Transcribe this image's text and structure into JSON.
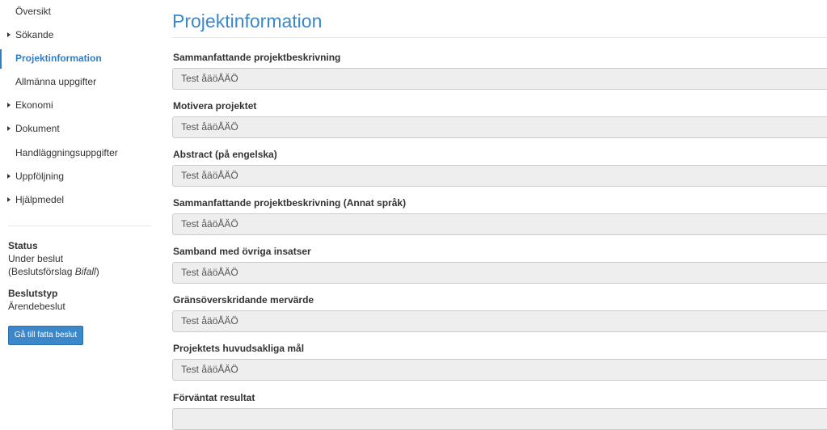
{
  "sidebar": {
    "nav": [
      {
        "label": "Översikt",
        "caret": false,
        "active": false
      },
      {
        "label": "Sökande",
        "caret": true,
        "active": false
      },
      {
        "label": "Projektinformation",
        "caret": false,
        "active": true
      },
      {
        "label": "Allmänna uppgifter",
        "caret": false,
        "active": false
      },
      {
        "label": "Ekonomi",
        "caret": true,
        "active": false
      },
      {
        "label": "Dokument",
        "caret": true,
        "active": false
      },
      {
        "label": "Handläggningsuppgifter",
        "caret": false,
        "active": false
      },
      {
        "label": "Uppföljning",
        "caret": true,
        "active": false
      },
      {
        "label": "Hjälpmedel",
        "caret": true,
        "active": false
      }
    ],
    "status": {
      "heading": "Status",
      "value": "Under beslut",
      "proposal_prefix": "(Beslutsförslag ",
      "proposal_value": "Bifall",
      "proposal_suffix": ")"
    },
    "decision_type": {
      "heading": "Beslutstyp",
      "value": "Ärendebeslut"
    },
    "decide_button": "Gå till fatta beslut"
  },
  "main": {
    "title": "Projektinformation",
    "fields": [
      {
        "label": "Sammanfattande projektbeskrivning",
        "value": "Test åäöÅÄÖ"
      },
      {
        "label": "Motivera projektet",
        "value": "Test åäöÅÄÖ"
      },
      {
        "label": "Abstract (på engelska)",
        "value": "Test åäöÅÄÖ"
      },
      {
        "label": "Sammanfattande projektbeskrivning (Annat språk)",
        "value": "Test åäöÅÄÖ"
      },
      {
        "label": "Samband med övriga insatser",
        "value": "Test åäöÅÄÖ"
      },
      {
        "label": "Gränsöverskridande mervärde",
        "value": "Test åäöÅÄÖ"
      },
      {
        "label": "Projektets huvudsakliga mål",
        "value": "Test åäöÅÄÖ"
      },
      {
        "label": "Förväntat resultat",
        "value": ""
      }
    ]
  },
  "colors": {
    "accent": "#3b87c9",
    "active_link": "#2f7ec3",
    "field_bg": "#eeeeee",
    "field_border": "#cccccc"
  }
}
